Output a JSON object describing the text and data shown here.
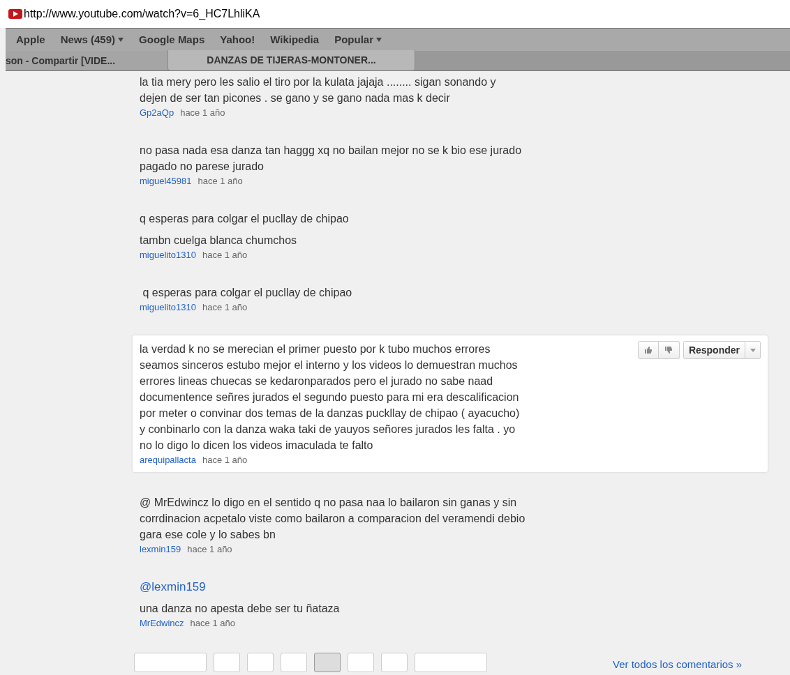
{
  "address_bar": {
    "url": "http://www.youtube.com/watch?v=6_HC7LhliKA"
  },
  "bookmarks": [
    {
      "label": "Apple",
      "menu": false
    },
    {
      "label": "News (459)",
      "menu": true
    },
    {
      "label": "Google Maps",
      "menu": false
    },
    {
      "label": "Yahoo!",
      "menu": false
    },
    {
      "label": "Wikipedia",
      "menu": false
    },
    {
      "label": "Popular",
      "menu": true
    }
  ],
  "tabs": [
    {
      "label": "son - Compartir [VIDE...",
      "selected": false
    },
    {
      "label": "DANZAS DE TIJERAS-MONTONER...",
      "selected": true
    }
  ],
  "comments": [
    {
      "highlighted": false,
      "paragraphs": [
        {
          "kind": "text",
          "lines": [
            "la tia mery pero les salio el tiro por la kulata jajaja ........ sigan sonando y",
            "dejen de ser tan picones . se gano y se gano nada mas k decir"
          ]
        }
      ],
      "author": "Gp2aQp",
      "time": "hace 1 año"
    },
    {
      "highlighted": false,
      "paragraphs": [
        {
          "kind": "text",
          "lines": [
            "no pasa nada esa danza tan haggg xq no bailan mejor no se k bio ese jurado",
            "pagado no parese jurado"
          ]
        }
      ],
      "author": "miguel45981",
      "time": "hace 1 año"
    },
    {
      "highlighted": false,
      "paragraphs": [
        {
          "kind": "text",
          "lines": [
            "q esperas para colgar el pucllay de chipao"
          ]
        },
        {
          "kind": "text",
          "lines": [
            "tambn cuelga blanca chumchos"
          ]
        }
      ],
      "author": "miguelito1310",
      "time": "hace 1 año"
    },
    {
      "highlighted": false,
      "paragraphs": [
        {
          "kind": "text",
          "lines": [
            " q esperas para colgar el pucllay de chipao"
          ]
        }
      ],
      "author": "miguelito1310",
      "time": "hace 1 año"
    },
    {
      "highlighted": true,
      "paragraphs": [
        {
          "kind": "text",
          "lines": [
            "la verdad k no se merecian el primer puesto por k tubo muchos errores",
            "seamos sinceros estubo mejor el interno y los videos lo demuestran muchos",
            "errores lineas chuecas se kedaronparados pero el jurado no sabe naad",
            "documentence señres jurados el segundo puesto para mi era descalificacion",
            "por meter o convinar dos temas de la danzas puckllay de chipao ( ayacucho)",
            "y conbinarlo con la danza waka taki de yauyos señores jurados les falta . yo",
            "no lo digo lo dicen los videos imaculada te falto"
          ]
        }
      ],
      "author": "arequipallacta",
      "time": "hace 1 año",
      "reply_label": "Responder"
    },
    {
      "highlighted": false,
      "paragraphs": [
        {
          "kind": "text",
          "lines": [
            "@ MrEdwincz lo digo en el sentido q no pasa naa lo bailaron sin ganas y sin",
            "corrdinacion acpetalo viste como bailaron a comparacion del veramendi debio",
            "gara ese cole y lo sabes bn"
          ]
        }
      ],
      "author": "lexmin159",
      "time": "hace 1 año"
    },
    {
      "highlighted": false,
      "paragraphs": [
        {
          "kind": "mention",
          "lines": [
            "@lexmin159"
          ]
        },
        {
          "kind": "text",
          "lines": [
            "una danza no apesta debe ser tu ñataza"
          ]
        }
      ],
      "author": "MrEdwincz",
      "time": "hace 1 año"
    }
  ],
  "pagination": [
    {
      "kind": "wide",
      "selected": false
    },
    {
      "kind": "page",
      "selected": false
    },
    {
      "kind": "page",
      "selected": false
    },
    {
      "kind": "page",
      "selected": false
    },
    {
      "kind": "page",
      "selected": true
    },
    {
      "kind": "page",
      "selected": false
    },
    {
      "kind": "page",
      "selected": false
    },
    {
      "kind": "wide",
      "selected": false
    }
  ],
  "all_comments_link": "Ver todos los comentarios »"
}
